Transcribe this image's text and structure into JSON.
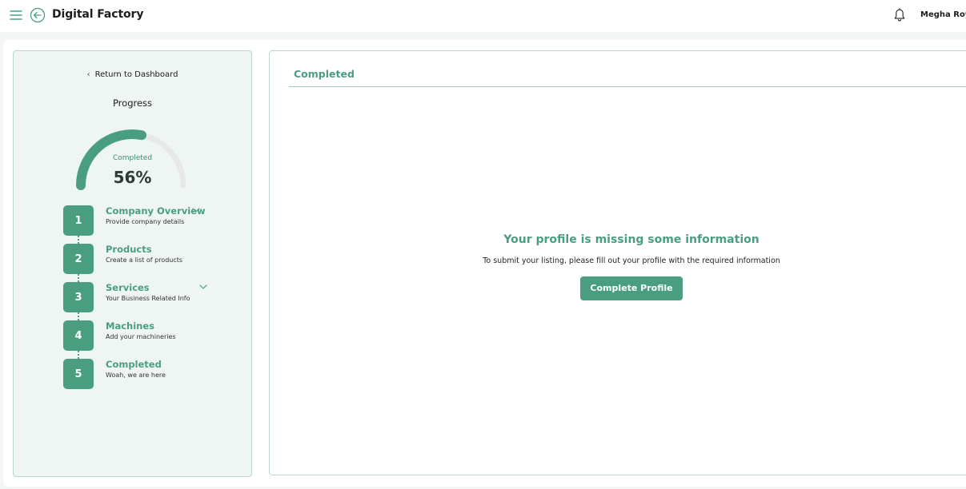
{
  "header": {
    "title": "Digital Factory",
    "user_name": "Megha Roy",
    "menu_icon": "hamburger-menu-icon",
    "back_icon": "back-circle-icon",
    "notification_icon": "bell-icon"
  },
  "sidebar": {
    "return_label": "Return to Dashboard",
    "progress_title": "Progress",
    "gauge": {
      "label": "Completed",
      "percent_text": "56%",
      "percent": 56
    },
    "steps": [
      {
        "number": "1",
        "title": "Company Overview",
        "subtitle": "Provide company details",
        "has_chevron": true
      },
      {
        "number": "2",
        "title": "Products",
        "subtitle": "Create a list of products",
        "has_chevron": false
      },
      {
        "number": "3",
        "title": "Services",
        "subtitle": "Your Business Related Info",
        "has_chevron": true
      },
      {
        "number": "4",
        "title": "Machines",
        "subtitle": "Add your machineries",
        "has_chevron": false
      },
      {
        "number": "5",
        "title": "Completed",
        "subtitle": "Woah, we are here",
        "has_chevron": false
      }
    ]
  },
  "main": {
    "section_title": "Completed",
    "empty_state": {
      "heading": "Your profile is missing some information",
      "message": "To submit your listing, please fill out your profile with the required information",
      "button_label": "Complete Profile"
    }
  },
  "colors": {
    "accent": "#4a9e80",
    "sidebar_bg": "#eef5f2",
    "border": "#b9d8cc",
    "gauge_track": "#e8e8e8"
  }
}
